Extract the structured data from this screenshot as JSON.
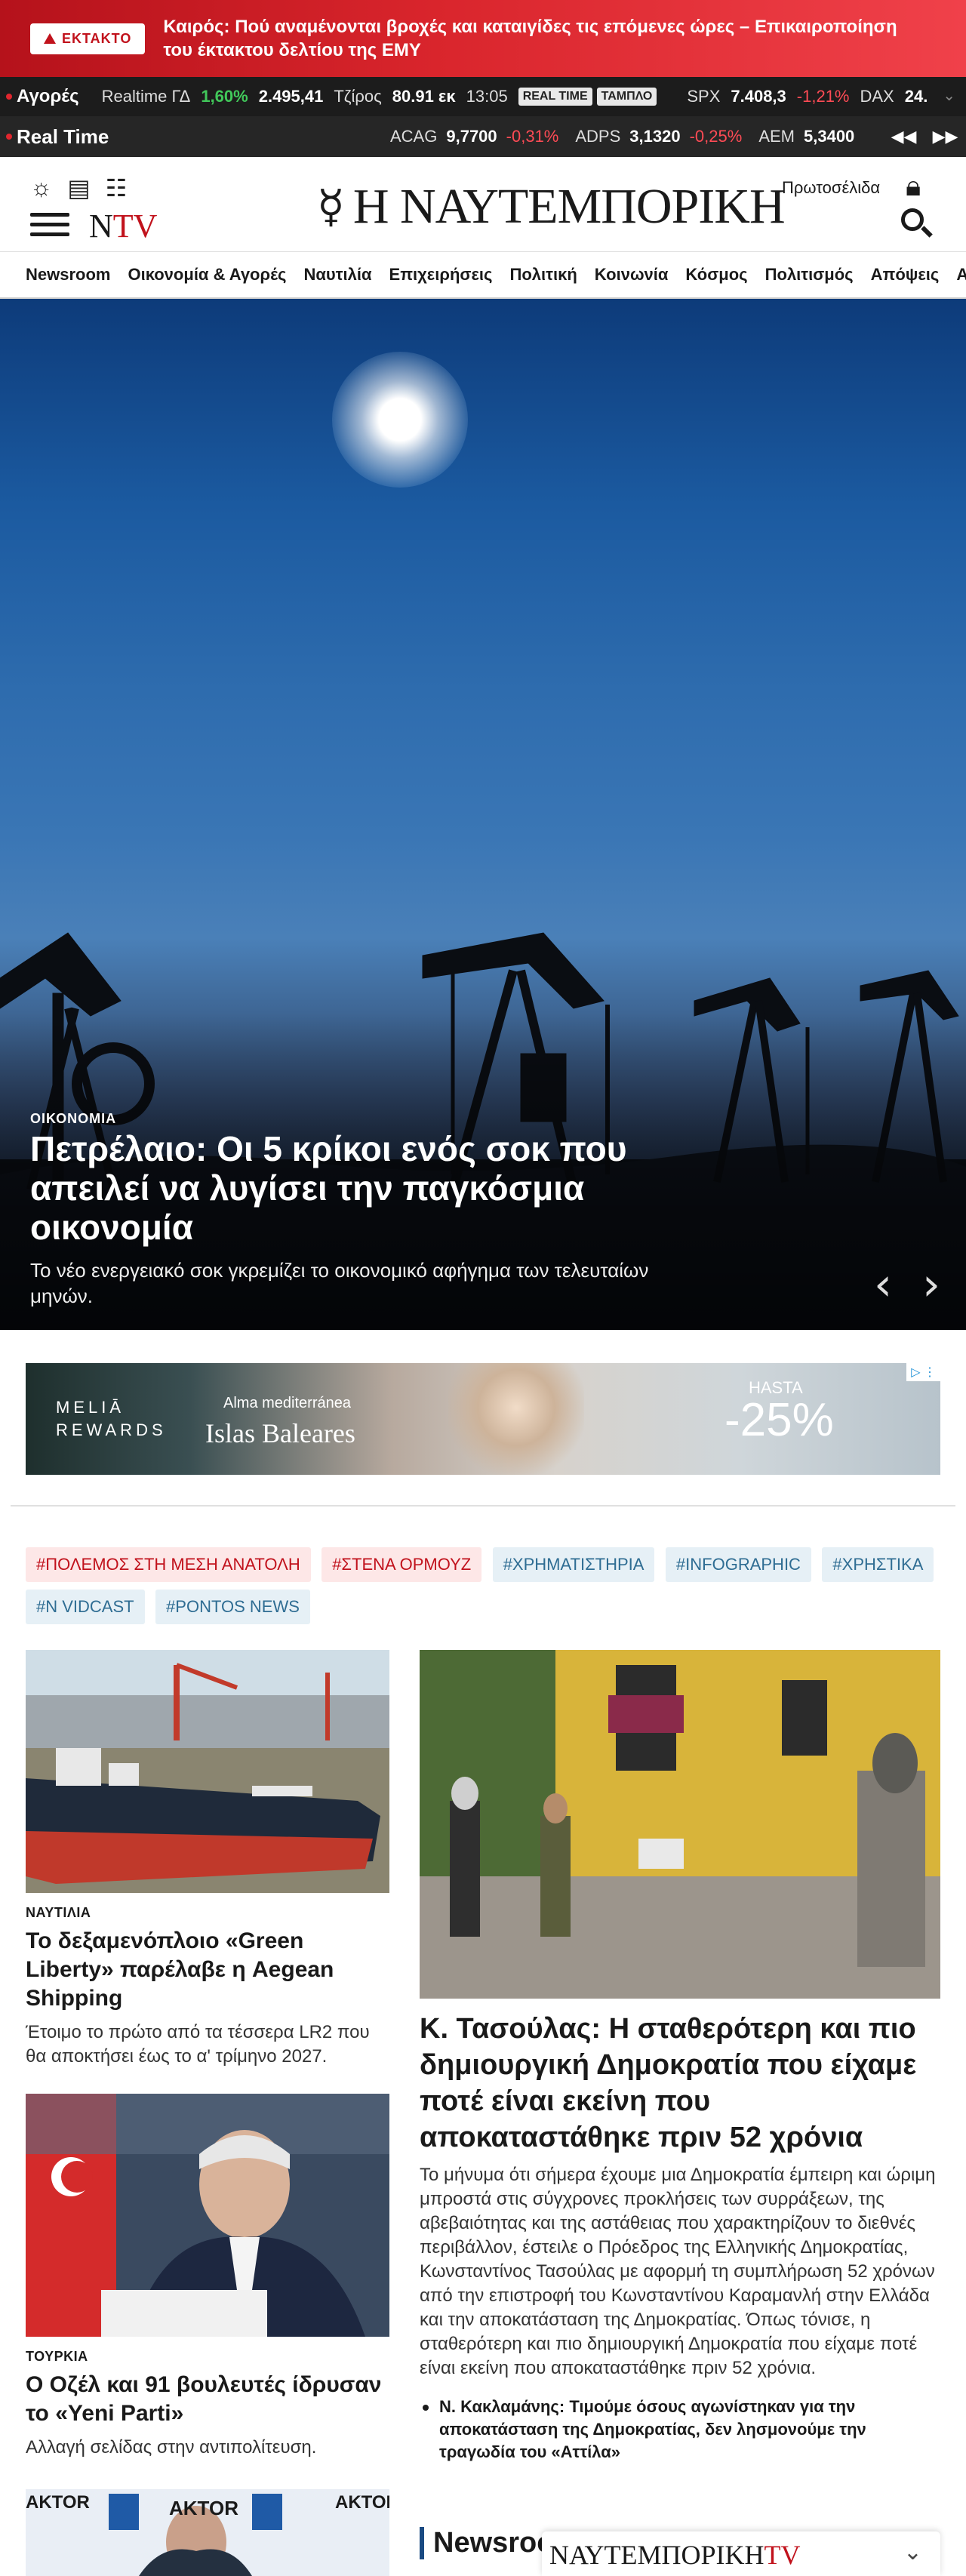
{
  "breaking": {
    "badge": "ΕΚΤΑΚΤΟ",
    "text": "Καιρός: Πού αναμένονται βροχές και καταιγίδες τις επόμενες ώρες – Επικαιροποίηση του έκτακτου δελτίου της ΕΜΥ"
  },
  "ticker": {
    "label": "Αγορές",
    "realtime_label": "Realtime ΓΔ",
    "gd_change": "1,60%",
    "gd_value": "2.495,41",
    "turnover_label": "Τζίρος",
    "turnover_value": "80.91 εκ",
    "time": "13:05",
    "pill_realtime": "REAL TIME",
    "pill_board": "ΤΑΜΠΛΟ",
    "spx_label": "SPX",
    "spx_value": "7.408,3",
    "spx_change": "-1,21%",
    "dax_label": "DAX",
    "dax_value": "24."
  },
  "realtime": {
    "label": "Real Time",
    "items": [
      {
        "name": "ACAG",
        "value": "9,7700",
        "change": "-0,31%"
      },
      {
        "name": "ADPS",
        "value": "3,1320",
        "change": "-0,25%"
      },
      {
        "name": "AEM",
        "value": "5,3400",
        "change": ""
      }
    ]
  },
  "header": {
    "logo": "Η ΝΑΥΤΕΜΠΟΡΙΚΗ",
    "ntv": "N",
    "ntv_accent": "TV",
    "frontpages": "Πρωτοσέλιδα"
  },
  "nav": [
    "Newsroom",
    "Οικονομία & Αγορές",
    "Ναυτιλία",
    "Επιχειρήσεις",
    "Πολιτική",
    "Κοινωνία",
    "Κόσμος",
    "Πολιτισμός",
    "Απόψεις",
    "Αθλη"
  ],
  "hero": {
    "category": "ΟΙΚΟΝΟΜΙΑ",
    "title": "Πετρέλαιο: Οι 5 κρίκοι ενός σοκ που απειλεί να λυγίσει την παγκόσμια οικονομία",
    "subtitle": "Το νέο ενεργειακό σοκ γκρεμίζει το οικονομικό αφήγημα των τελευταίων μηνών."
  },
  "ad": {
    "brand_line1": "MELIĀ",
    "brand_line2": "REWARDS",
    "tagline1": "Alma mediterránea",
    "tagline2": "Islas Baleares",
    "hasta": "HASTA",
    "discount": "-25%"
  },
  "tags": [
    {
      "label": "#ΠΟΛΕΜΟΣ ΣΤΗ ΜΕΣΗ ΑΝΑΤΟΛΗ",
      "style": "red"
    },
    {
      "label": "#ΣΤΕΝΑ ΟΡΜΟΥΖ",
      "style": "red"
    },
    {
      "label": "#ΧΡΗΜΑΤΙΣΤΗΡΙΑ",
      "style": "blue"
    },
    {
      "label": "#INFOGRAPHIC",
      "style": "blue"
    },
    {
      "label": "#ΧΡΗΣΤΙΚΑ",
      "style": "blue"
    },
    {
      "label": "#N VIDCAST",
      "style": "blue"
    },
    {
      "label": "#PONTOS NEWS",
      "style": "blue"
    }
  ],
  "articles": {
    "a1": {
      "category": "ΝΑΥΤΙΛΙΑ",
      "title": "Το δεξαμενόπλοιο «Green Liberty» παρέλαβε η Aegean Shipping",
      "desc": "Έτοιμο το πρώτο από τα τέσσερα LR2 που θα αποκτήσει έως το α' τρίμηνο 2027."
    },
    "a2": {
      "category": "ΤΟΥΡΚΙΑ",
      "title": "Ο Οζέλ και 91 βουλευτές ίδρυσαν το «Yeni Parti»",
      "desc": "Αλλαγή σελίδας στην αντιπολίτευση."
    },
    "big": {
      "title": "Κ. Τασούλας: Η σταθερότερη και πιο δημιουργική Δημοκρατία που είχαμε ποτέ είναι εκείνη που αποκαταστάθηκε πριν 52 χρόνια",
      "desc": "Το μήνυμα ότι σήμερα έχουμε μια Δημοκρατία έμπειρη και ώριμη μπροστά στις σύγχρονες προκλήσεις των συρράξεων, της αβεβαιότητας και της αστάθειας που χαρακτηρίζουν το διεθνές περιβάλλον, έστειλε ο Πρόεδρος της Ελληνικής Δημοκρατίας, Κωνσταντίνος Τασούλας με αφορμή τη συμπλήρωση 52 χρόνων από την επιστροφή του Κωνσταντίνου Καραμανλή στην Ελλάδα και την αποκατάσταση της Δημοκρατίας. Όπως τόνισε, η σταθερότερη και πιο δημιουργική Δημοκρατία που είχαμε ποτέ είναι εκείνη που αποκαταστάθηκε πριν 52 χρόνια.",
      "related": "Ν. Κακλαμάνης: Τιμούμε όσους αγωνίστηκαν για την αποκατάσταση της Δημοκρατίας, δεν λησμονούμε την τραγωδία του «Αττίλα»"
    }
  },
  "thumb3_brand": "AKTOR",
  "section": {
    "newsroom": "Newsroom"
  },
  "tvbar": {
    "logo": "ΝΑΥΤΕΜΠΟΡΙΚΗ",
    "logo_accent": "TV"
  }
}
